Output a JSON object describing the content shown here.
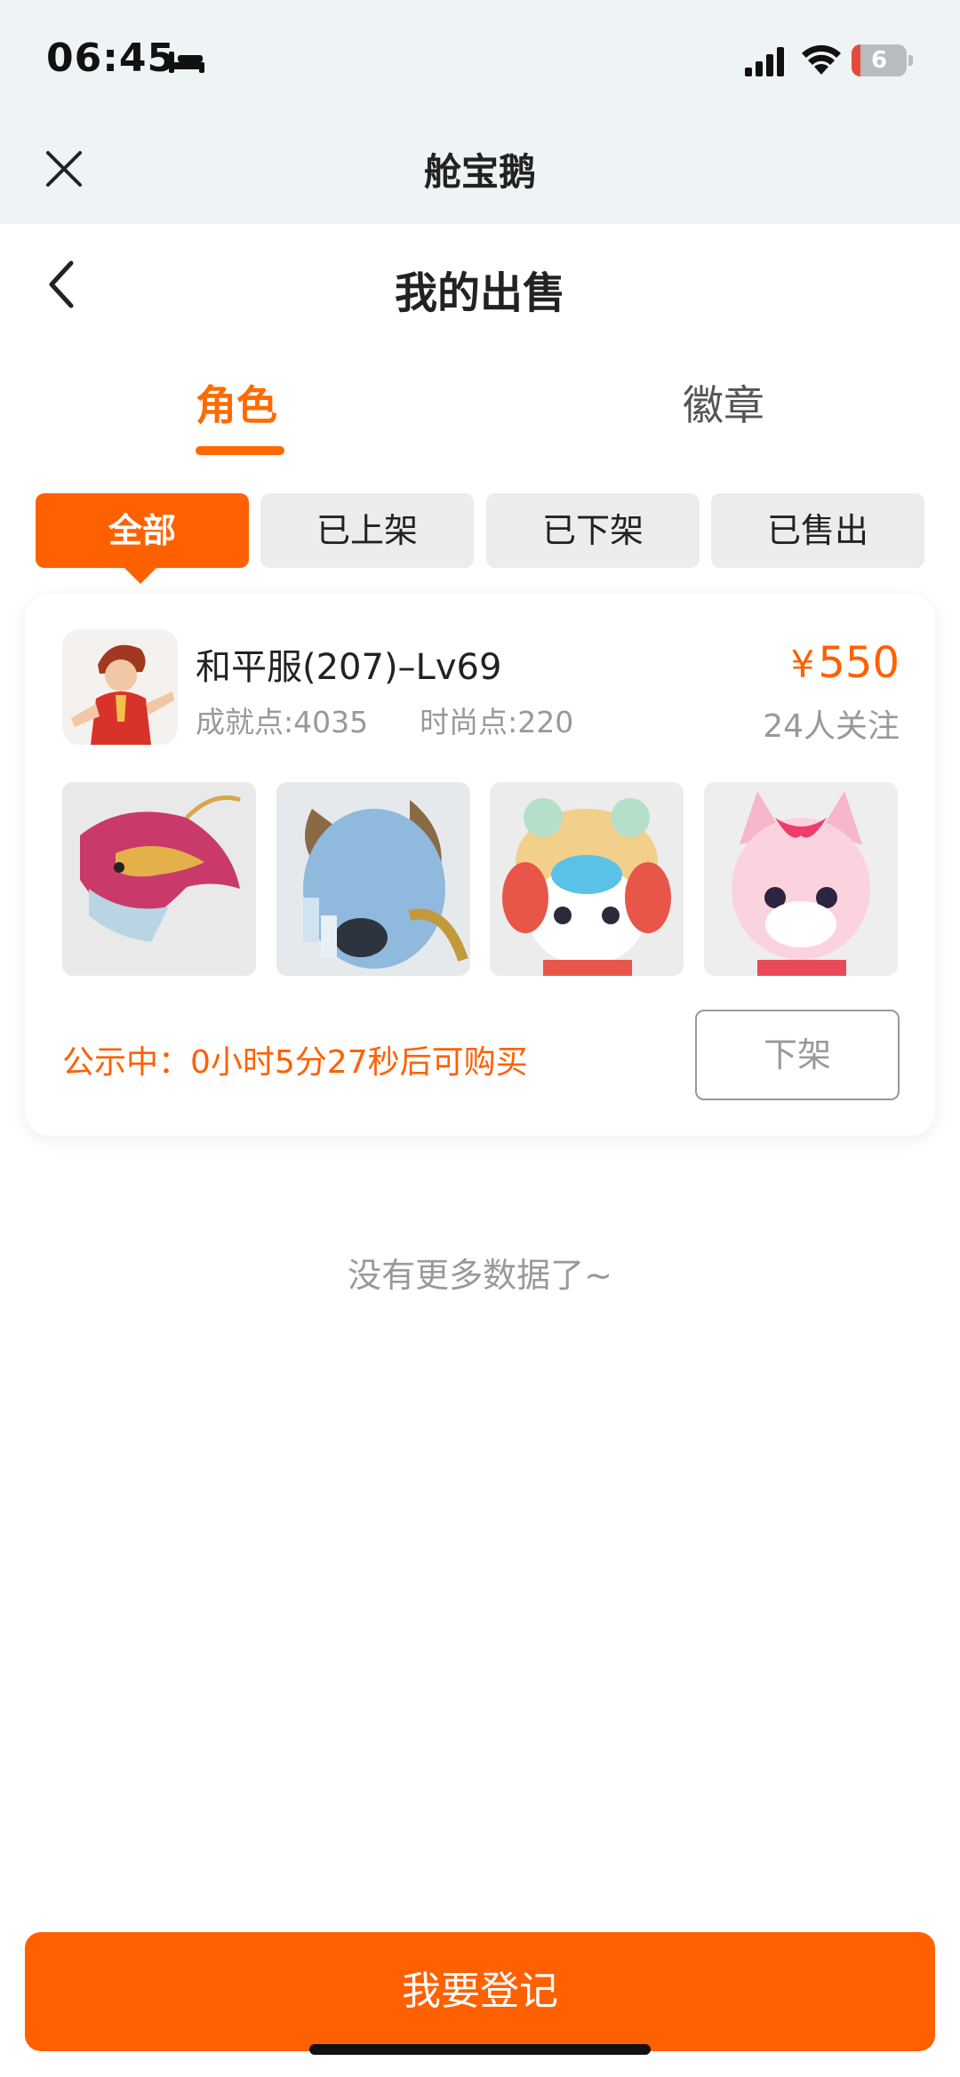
{
  "status_bar": {
    "time": "06:45",
    "battery": "6"
  },
  "miniprogram": {
    "title": "舱宝鹅"
  },
  "header": {
    "title": "我的出售"
  },
  "tabs": [
    {
      "label": "角色",
      "active": true
    },
    {
      "label": "徽章",
      "active": false
    }
  ],
  "filters": [
    {
      "label": "全部",
      "active": true
    },
    {
      "label": "已上架",
      "active": false
    },
    {
      "label": "已下架",
      "active": false
    },
    {
      "label": "已售出",
      "active": false
    }
  ],
  "listing": {
    "name": "和平服(207)–Lv69",
    "achievement": "成就点:4035",
    "fashion": "时尚点:220",
    "currency": "¥",
    "price": "550",
    "followers": "24人关注",
    "countdown": "公示中：0小时5分27秒后可购买",
    "delist_label": "下架",
    "thumbnails": [
      "dragon-image",
      "blue-beast-image",
      "lion-dance-pet-image",
      "pink-fox-pet-image"
    ]
  },
  "footer_note": "没有更多数据了~",
  "register_button": "我要登记",
  "colors": {
    "accent": "#ff6000",
    "muted": "#999999",
    "chip_bg": "#ececec"
  }
}
